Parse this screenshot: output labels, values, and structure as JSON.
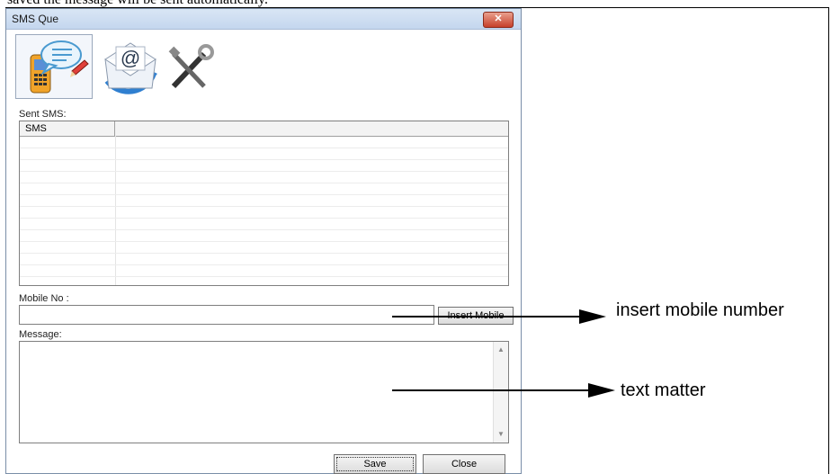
{
  "document": {
    "caption_fragment": "saved the message will be sent automatically."
  },
  "window": {
    "title": "SMS Que",
    "close_glyph": "✕"
  },
  "toolbar": {
    "icons": [
      "sms-phone-icon",
      "email-icon",
      "tools-icon"
    ]
  },
  "sent_sms": {
    "label": "Sent SMS:",
    "columns": [
      "SMS",
      ""
    ],
    "rows": []
  },
  "mobile": {
    "label": "Mobile No :",
    "value": "",
    "insert_label": "Insert Mobile"
  },
  "message": {
    "label": "Message:",
    "value": ""
  },
  "buttons": {
    "save_label": "Save",
    "close_label": "Close"
  },
  "annotations": {
    "insert_mobile": "insert mobile number",
    "text_matter": "text matter"
  },
  "colors": {
    "titlebar": "#c4d6ee",
    "close_button": "#c7402a"
  }
}
